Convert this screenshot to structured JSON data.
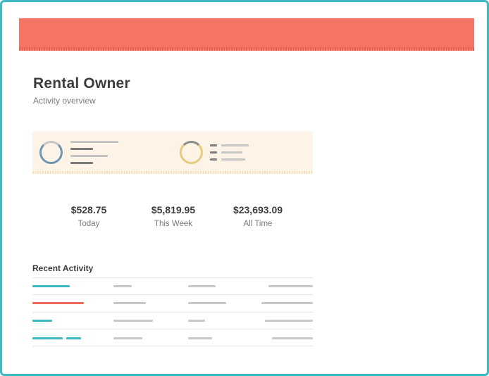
{
  "header": {
    "color": "#f47563"
  },
  "page": {
    "title": "Rental Owner",
    "subtitle": "Activity overview"
  },
  "summary": {
    "panel_color": "#fdf3e6",
    "ring_colors": [
      "#6e97b3",
      "#e5cb7d"
    ]
  },
  "stats": [
    {
      "amount": "$528.75",
      "label": "Today"
    },
    {
      "amount": "$5,819.95",
      "label": "This Week"
    },
    {
      "amount": "$23,693.09",
      "label": "All Time"
    }
  ],
  "recent_activity": {
    "title": "Recent Activity",
    "accent_colors": [
      "#3dbac1",
      "#ee6a57",
      "#3dbac1",
      "#3dbac1"
    ]
  }
}
